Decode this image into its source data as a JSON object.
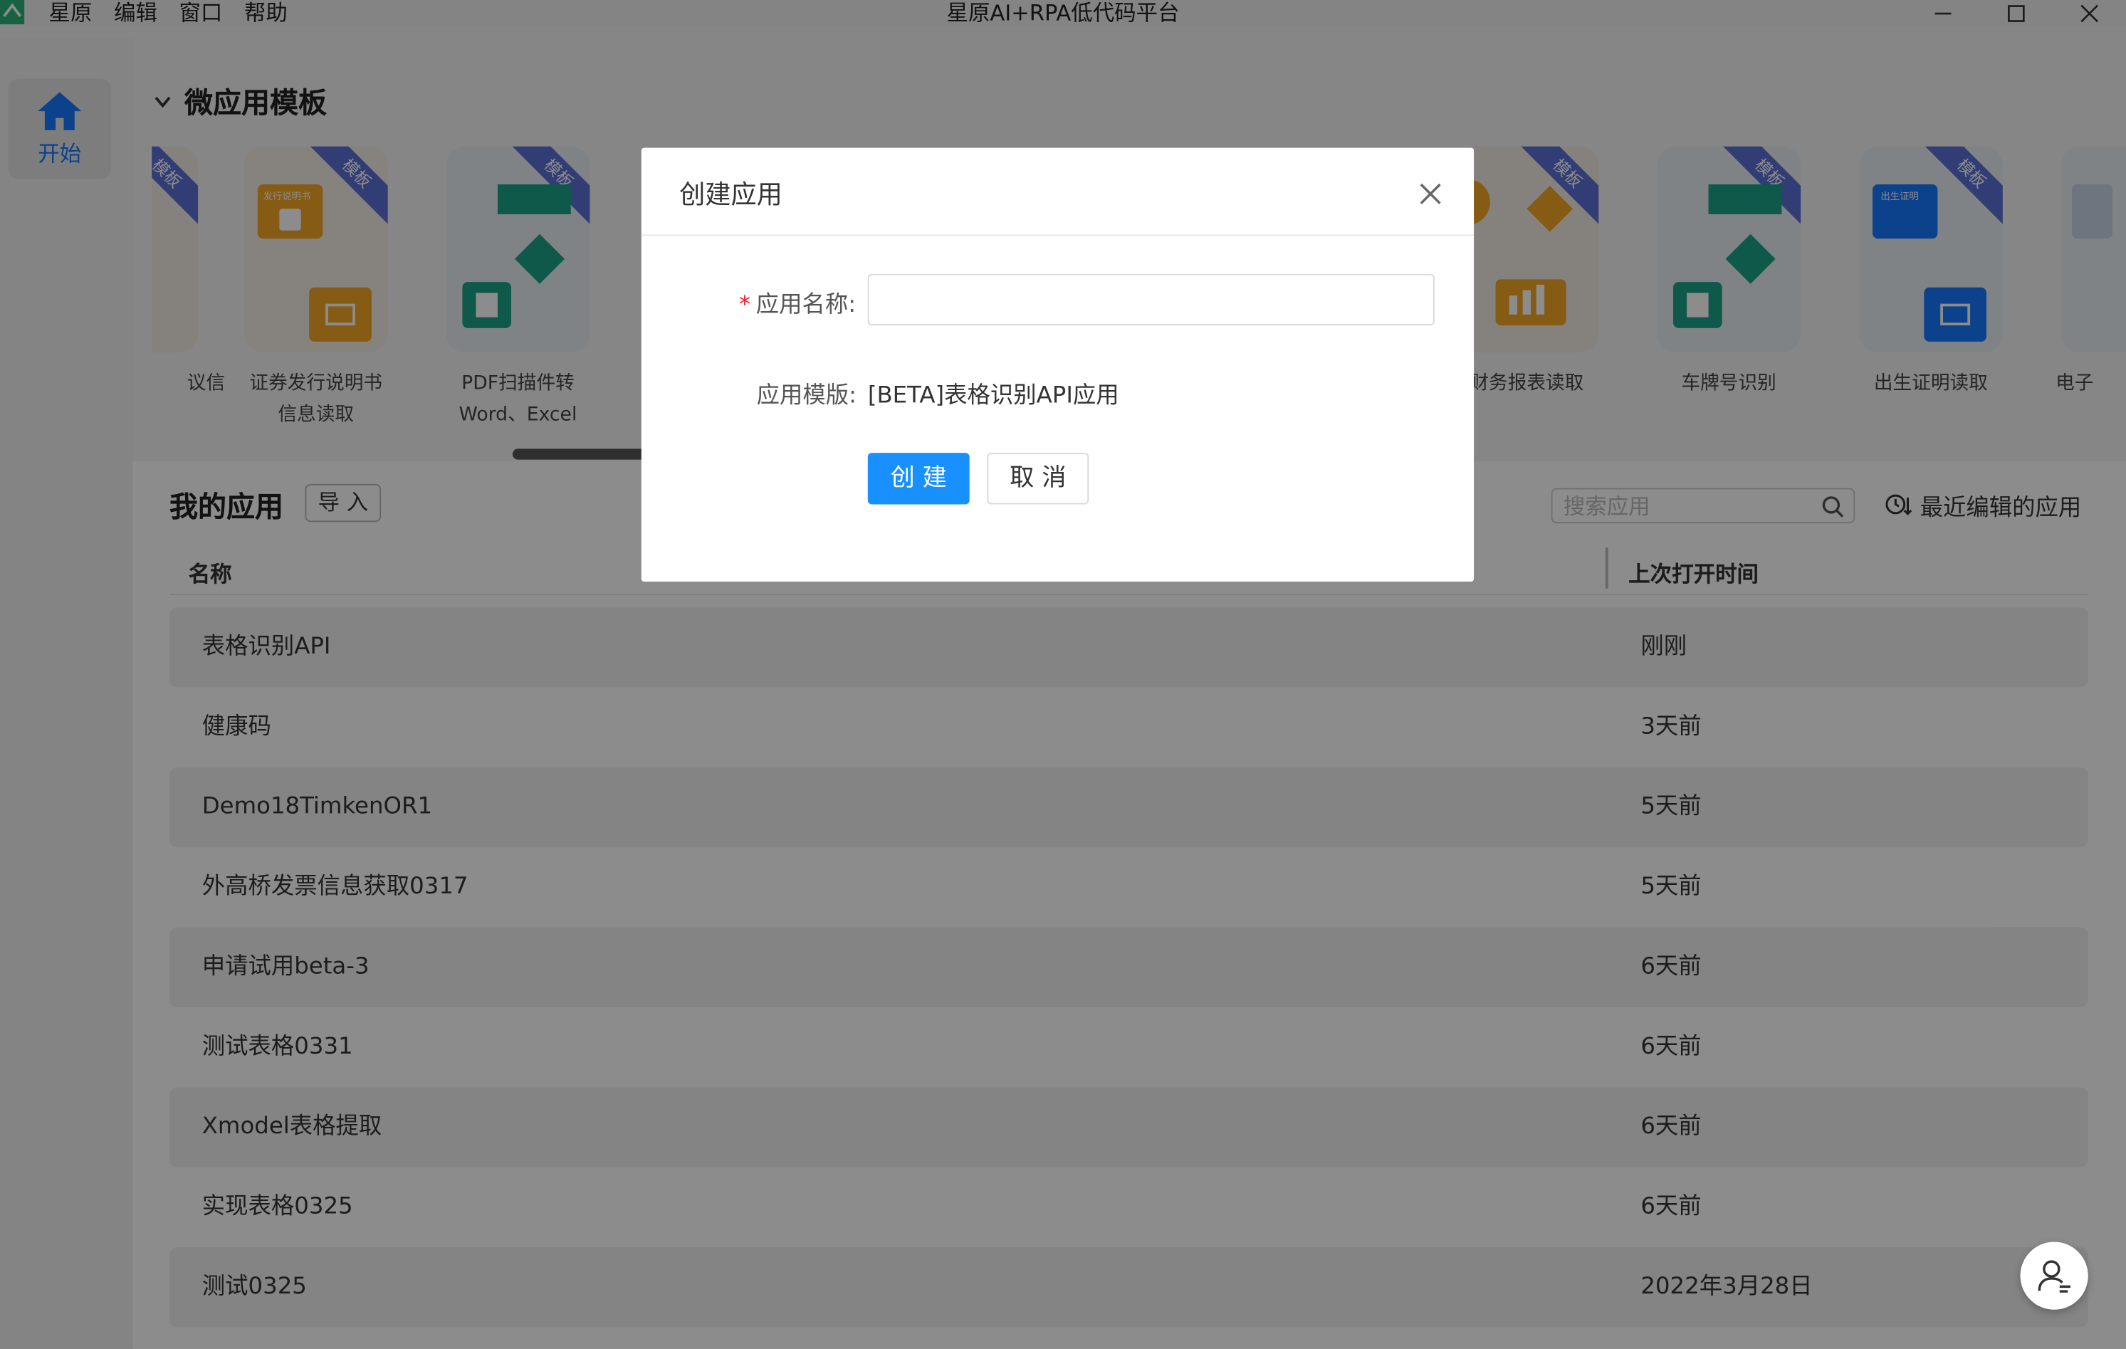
{
  "window": {
    "title": "星原AI+RPA低代码平台",
    "menu": [
      "星原",
      "编辑",
      "窗口",
      "帮助"
    ]
  },
  "rail": {
    "start_label": "开始"
  },
  "templates": {
    "section_title": "微应用模板",
    "ribbon": "模板",
    "items": [
      {
        "name": "议信"
      },
      {
        "name": "证券发行说明书\n信息读取"
      },
      {
        "name": "PDF扫描件转\nWord、Excel"
      },
      {
        "name": "财务报表读取"
      },
      {
        "name": "车牌号识别"
      },
      {
        "name": "出生证明读取"
      },
      {
        "name": "电子"
      }
    ],
    "card_text": {
      "securities": "发行说明书",
      "birth": "出生证明"
    }
  },
  "my_apps": {
    "title": "我的应用",
    "import_label": "导 入",
    "search_placeholder": "搜索应用",
    "recent_label": "最近编辑的应用",
    "col_name": "名称",
    "col_time": "上次打开时间",
    "rows": [
      {
        "name": "表格识别API",
        "time": "刚刚"
      },
      {
        "name": "健康码",
        "time": "3天前"
      },
      {
        "name": "Demo18TimkenOR1",
        "time": "5天前"
      },
      {
        "name": "外高桥发票信息获取0317",
        "time": "5天前"
      },
      {
        "name": "申请试用beta-3",
        "time": "6天前"
      },
      {
        "name": "测试表格0331",
        "time": "6天前"
      },
      {
        "name": "Xmodel表格提取",
        "time": "6天前"
      },
      {
        "name": "实现表格0325",
        "time": "6天前"
      },
      {
        "name": "测试0325",
        "time": "2022年3月28日"
      }
    ]
  },
  "modal": {
    "title": "创建应用",
    "required_mark": "*",
    "name_label": "应用名称:",
    "name_value": "",
    "template_label": "应用模版:",
    "template_value": "[BETA]表格识别API应用",
    "create_label": "创 建",
    "cancel_label": "取 消"
  },
  "colors": {
    "accent": "#1890ff",
    "rail_accent": "#1677ff",
    "required": "#f5222d",
    "ribbon": "#5b6dd6"
  },
  "icons": [
    "app-logo-icon",
    "minimize-icon",
    "maximize-icon",
    "window-close-icon",
    "home-icon",
    "chevron-down-icon",
    "search-icon",
    "recent-clock-icon",
    "modal-close-icon",
    "support-agent-icon"
  ]
}
